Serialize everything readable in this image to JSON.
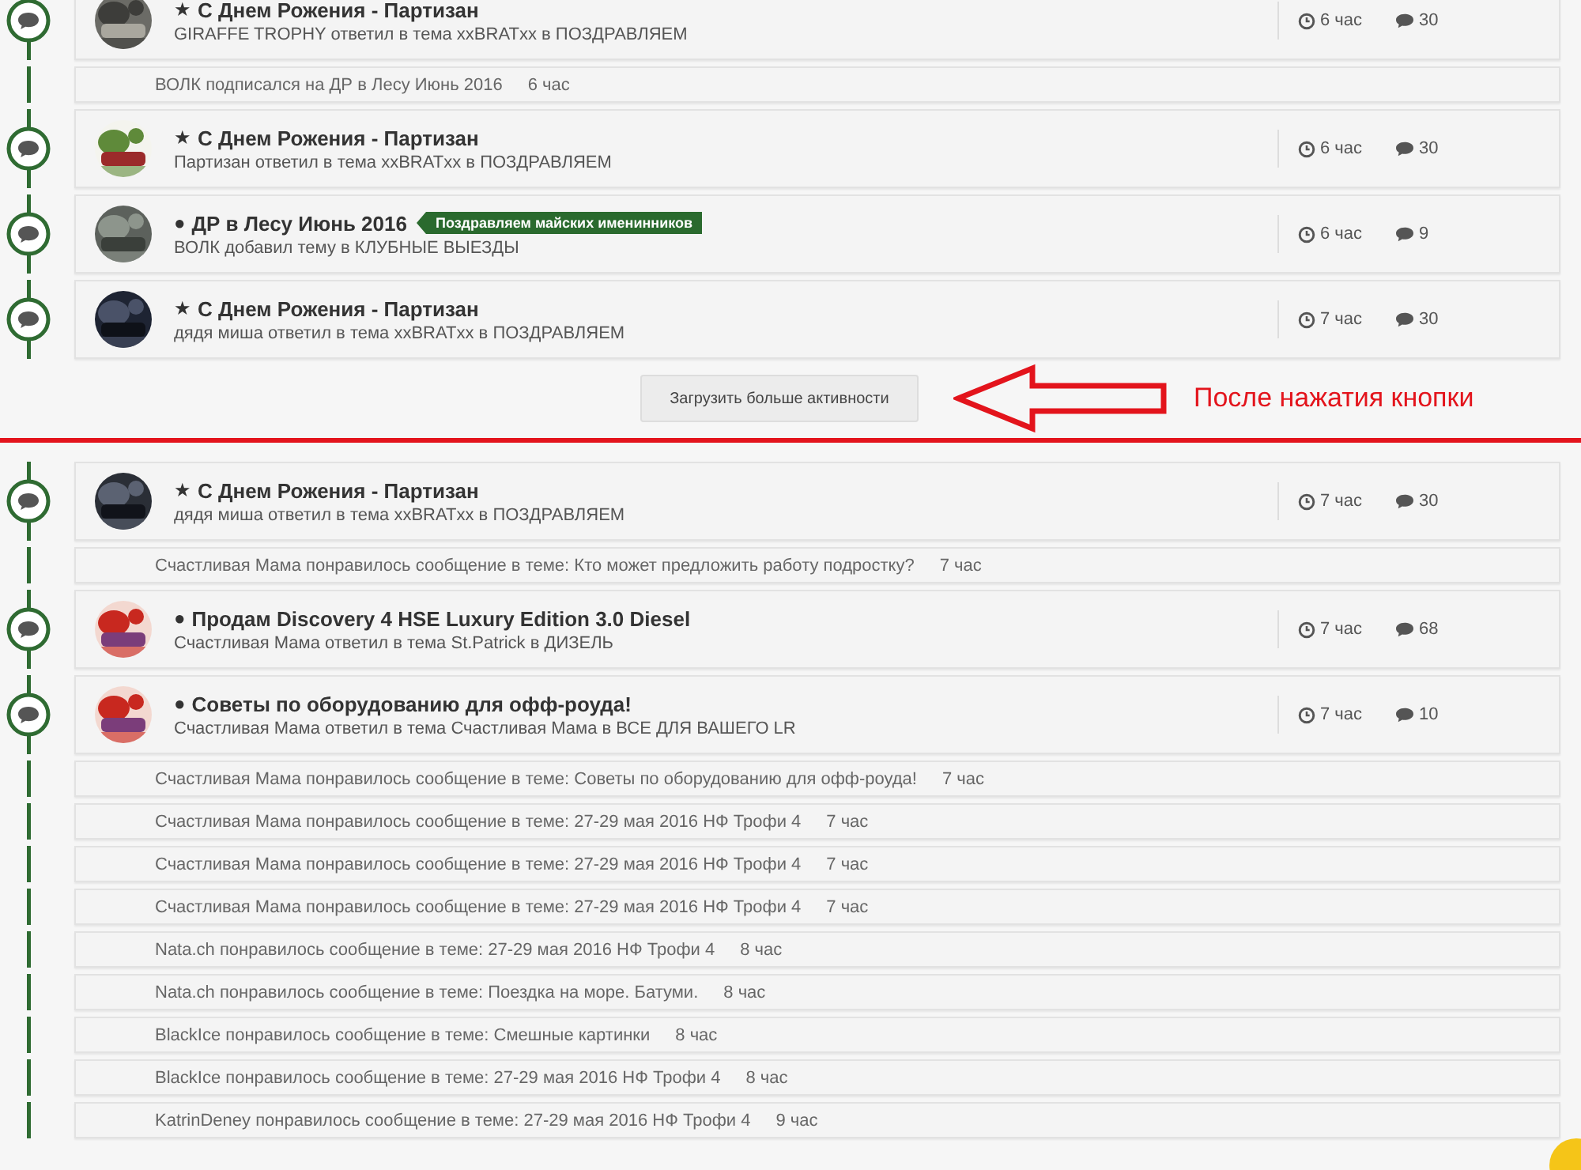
{
  "before": {
    "rows": [
      {
        "kind": "topic",
        "mark": "★",
        "title": "С Днем Рожения - Партизан",
        "summary": "GIRAFFE TROPHY ответил в тема xxBRATxx в ПОЗДРАВЛЯЕМ",
        "time": "6 час",
        "replies": "30"
      },
      {
        "kind": "like",
        "text": "ВОЛК подписался на ДР в Лесу Июнь 2016",
        "time": "6 час"
      },
      {
        "kind": "topic",
        "mark": "★",
        "title": "С Днем Рожения - Партизан",
        "summary": "Партизан ответил в тема xxBRATxx в ПОЗДРАВЛЯЕМ",
        "time": "6 час",
        "replies": "30"
      },
      {
        "kind": "topic",
        "mark": "●",
        "title": "ДР в Лесу Июнь 2016",
        "badge": "Поздравляем майских именинников",
        "summary": "ВОЛК добавил тему в КЛУБНЫЕ ВЫЕЗДЫ",
        "time": "6 час",
        "replies": "9"
      },
      {
        "kind": "topic",
        "mark": "★",
        "title": "С Днем Рожения - Партизан",
        "summary": "дядя миша ответил в тема xxBRATxx в ПОЗДРАВЛЯЕМ",
        "time": "7 час",
        "replies": "30"
      }
    ]
  },
  "load_more_button": {
    "label": "Загрузить больше активности"
  },
  "annotation": {
    "text": "После нажатия кнопки"
  },
  "after": {
    "rows": [
      {
        "kind": "topic",
        "mark": "★",
        "title": "С Днем Рожения - Партизан",
        "summary": "дядя миша ответил в тема xxBRATxx в ПОЗДРАВЛЯЕМ",
        "time": "7 час",
        "replies": "30"
      },
      {
        "kind": "like",
        "text": "Счастливая Мама понравилось сообщение в теме: Кто может предложить работу подростку?",
        "time": "7 час"
      },
      {
        "kind": "topic",
        "mark": "●",
        "title": "Продам Discovery 4 HSE Luxury Edition 3.0 Diesel",
        "summary": "Счастливая Мама ответил в тема St.Patrick в ДИЗЕЛЬ",
        "time": "7 час",
        "replies": "68"
      },
      {
        "kind": "topic",
        "mark": "●",
        "title": "Советы по оборудованию для офф-роуда!",
        "summary": "Счастливая Мама ответил в тема Счастливая Мама в ВСЕ ДЛЯ ВАШЕГО LR",
        "time": "7 час",
        "replies": "10"
      },
      {
        "kind": "like",
        "text": "Счастливая Мама понравилось сообщение в теме: Советы по оборудованию для офф-роуда!",
        "time": "7 час"
      },
      {
        "kind": "like",
        "text": "Счастливая Мама понравилось сообщение в теме: 27-29 мая 2016 НФ Трофи 4",
        "time": "7 час"
      },
      {
        "kind": "like",
        "text": "Счастливая Мама понравилось сообщение в теме: 27-29 мая 2016 НФ Трофи 4",
        "time": "7 час"
      },
      {
        "kind": "like",
        "text": "Счастливая Мама понравилось сообщение в теме: 27-29 мая 2016 НФ Трофи 4",
        "time": "7 час"
      },
      {
        "kind": "like",
        "text": "Nata.ch понравилось сообщение в теме: 27-29 мая 2016 НФ Трофи 4",
        "time": "8 час"
      },
      {
        "kind": "like",
        "text": "Nata.ch понравилось сообщение в теме: Поездка на море. Батуми.",
        "time": "8 час"
      },
      {
        "kind": "like",
        "text": "BlackIce понравилось сообщение в теме: Смешные картинки",
        "time": "8 час"
      },
      {
        "kind": "like",
        "text": "BlackIce понравилось сообщение в теме: 27-29 мая 2016 НФ Трофи 4",
        "time": "8 час"
      },
      {
        "kind": "like",
        "text": "KatrinDeney понравилось сообщение в теме: 27-29 мая 2016 НФ Трофи 4",
        "time": "9 час"
      }
    ]
  }
}
